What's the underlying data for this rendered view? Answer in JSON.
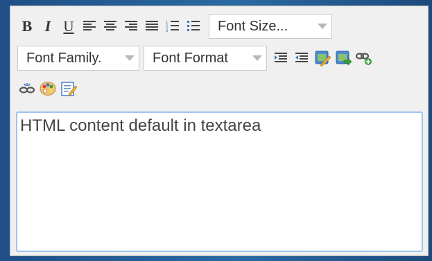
{
  "toolbar": {
    "buttons_row1": [
      {
        "name": "bold-button",
        "icon": "bold-icon",
        "glyph": "B"
      },
      {
        "name": "italic-button",
        "icon": "italic-icon",
        "glyph": "I"
      },
      {
        "name": "underline-button",
        "icon": "underline-icon",
        "glyph": "U"
      },
      {
        "name": "align-left-button",
        "icon": "align-left-icon"
      },
      {
        "name": "align-center-button",
        "icon": "align-center-icon"
      },
      {
        "name": "align-right-button",
        "icon": "align-right-icon"
      },
      {
        "name": "justify-button",
        "icon": "justify-icon"
      },
      {
        "name": "ordered-list-button",
        "icon": "ordered-list-icon"
      },
      {
        "name": "unordered-list-button",
        "icon": "unordered-list-icon"
      }
    ],
    "font_size": {
      "label": "Font Size..."
    },
    "font_family": {
      "label": "Font Family."
    },
    "font_format": {
      "label": "Font Format"
    },
    "buttons_row2": [
      {
        "name": "indent-button",
        "icon": "indent-icon"
      },
      {
        "name": "outdent-button",
        "icon": "outdent-icon"
      },
      {
        "name": "edit-image-button",
        "icon": "edit-image-icon"
      },
      {
        "name": "insert-image-button",
        "icon": "insert-image-icon"
      },
      {
        "name": "insert-link-button",
        "icon": "link-add-icon"
      }
    ],
    "buttons_row3": [
      {
        "name": "unlink-button",
        "icon": "unlink-icon"
      },
      {
        "name": "color-button",
        "icon": "palette-icon"
      },
      {
        "name": "source-edit-button",
        "icon": "source-edit-icon"
      }
    ]
  },
  "editor": {
    "content": "HTML content default in textarea"
  },
  "colors": {
    "background": "#1f4f86",
    "toolbar_bg": "#f0f0f0",
    "content_border": "#9ec3ef"
  }
}
